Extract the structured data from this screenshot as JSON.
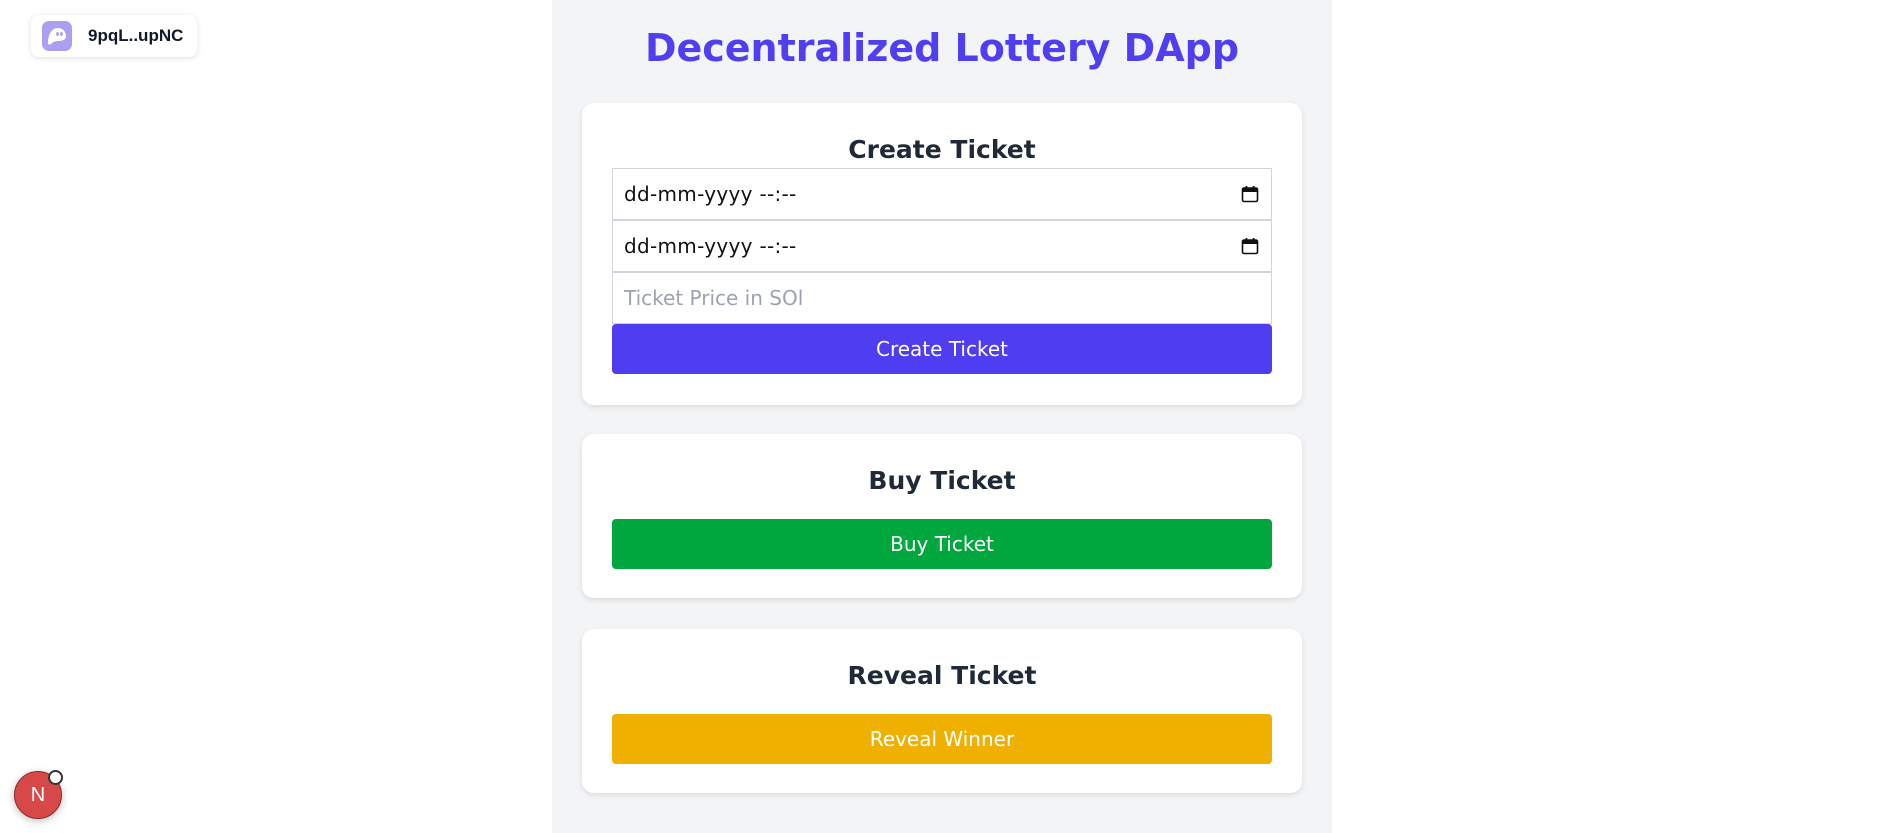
{
  "wallet": {
    "address": "9pqL..upNC",
    "icon": "phantom-ghost-icon",
    "icon_color": "#ab9ff2"
  },
  "page": {
    "title": "Decentralized Lottery DApp",
    "title_color": "#4f3ff0"
  },
  "create_ticket": {
    "heading": "Create Ticket",
    "start_time_value": "dd-mm-yyyy --:--",
    "end_time_value": "dd-mm-yyyy --:--",
    "price_placeholder": "Ticket Price in SOl",
    "button_label": "Create Ticket",
    "button_color": "#4f3df2"
  },
  "buy_ticket": {
    "heading": "Buy Ticket",
    "button_label": "Buy Ticket",
    "button_color": "#00a63e"
  },
  "reveal_ticket": {
    "heading": "Reveal Ticket",
    "button_label": "Reveal Winner",
    "button_color": "#efb000"
  },
  "dev_badge": {
    "letter": "N",
    "color": "#d74848"
  }
}
